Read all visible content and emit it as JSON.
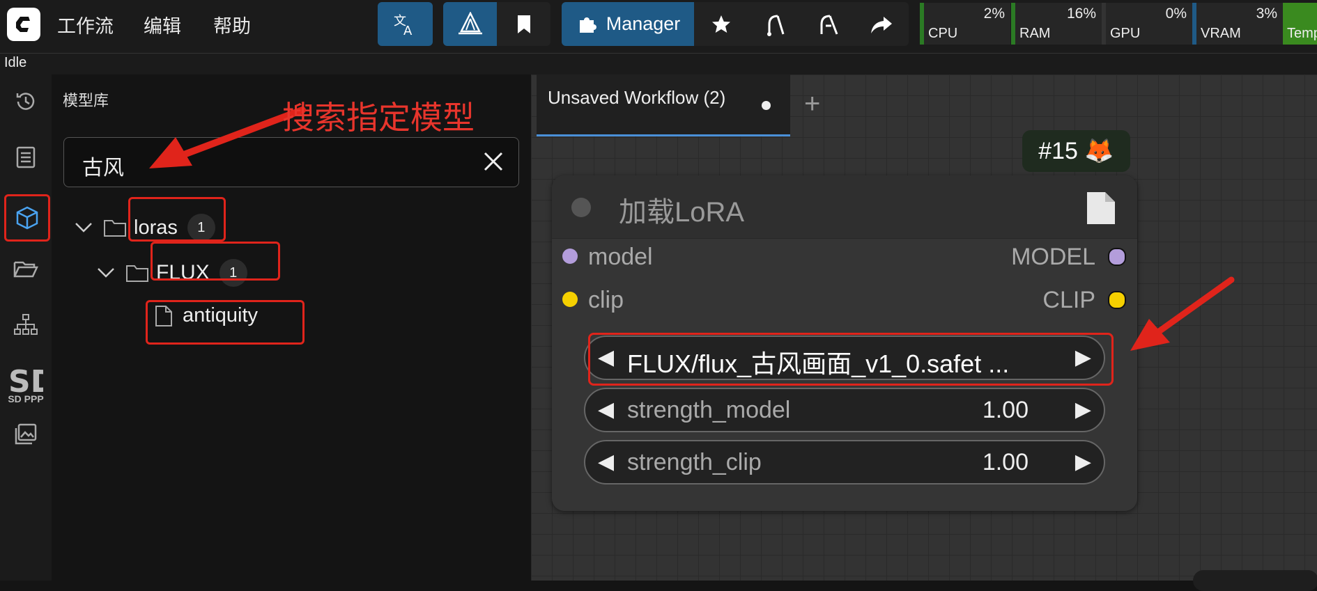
{
  "menu": {
    "workflow": "工作流",
    "edit": "编辑",
    "help": "帮助"
  },
  "toolbar": {
    "manager_label": "Manager"
  },
  "stats": [
    {
      "label": "CPU",
      "value": "2%"
    },
    {
      "label": "RAM",
      "value": "16%"
    },
    {
      "label": "GPU",
      "value": "0%"
    },
    {
      "label": "VRAM",
      "value": "3%"
    },
    {
      "label": "Temp",
      "value": ""
    }
  ],
  "status": {
    "text": "Idle"
  },
  "sidebar": {
    "sdppp_label": "SD PPP"
  },
  "library": {
    "title": "模型库",
    "search_value": "古风",
    "tree": [
      {
        "label": "loras",
        "count": "1"
      },
      {
        "label": "FLUX",
        "count": "1"
      },
      {
        "label": "antiquity"
      }
    ]
  },
  "annotation": {
    "text": "搜索指定模型"
  },
  "tabs": [
    {
      "label": "Unsaved Workflow (2)"
    }
  ],
  "node": {
    "id_tag": "#15 🦊",
    "title": "加载LoRA",
    "inputs": [
      {
        "label": "model"
      },
      {
        "label": "clip"
      }
    ],
    "outputs": [
      {
        "label": "MODEL"
      },
      {
        "label": "CLIP"
      }
    ],
    "lora_name": "FLUX/flux_古风画面_v1_0.safet  ...",
    "widgets": [
      {
        "label": "strength_model",
        "value": "1.00"
      },
      {
        "label": "strength_clip",
        "value": "1.00"
      }
    ]
  },
  "colors": {
    "accent": "#1f5a86",
    "annotation_red": "#e0241b",
    "clip_yellow": "#f5d000",
    "model_purple": "#b39ddb"
  }
}
